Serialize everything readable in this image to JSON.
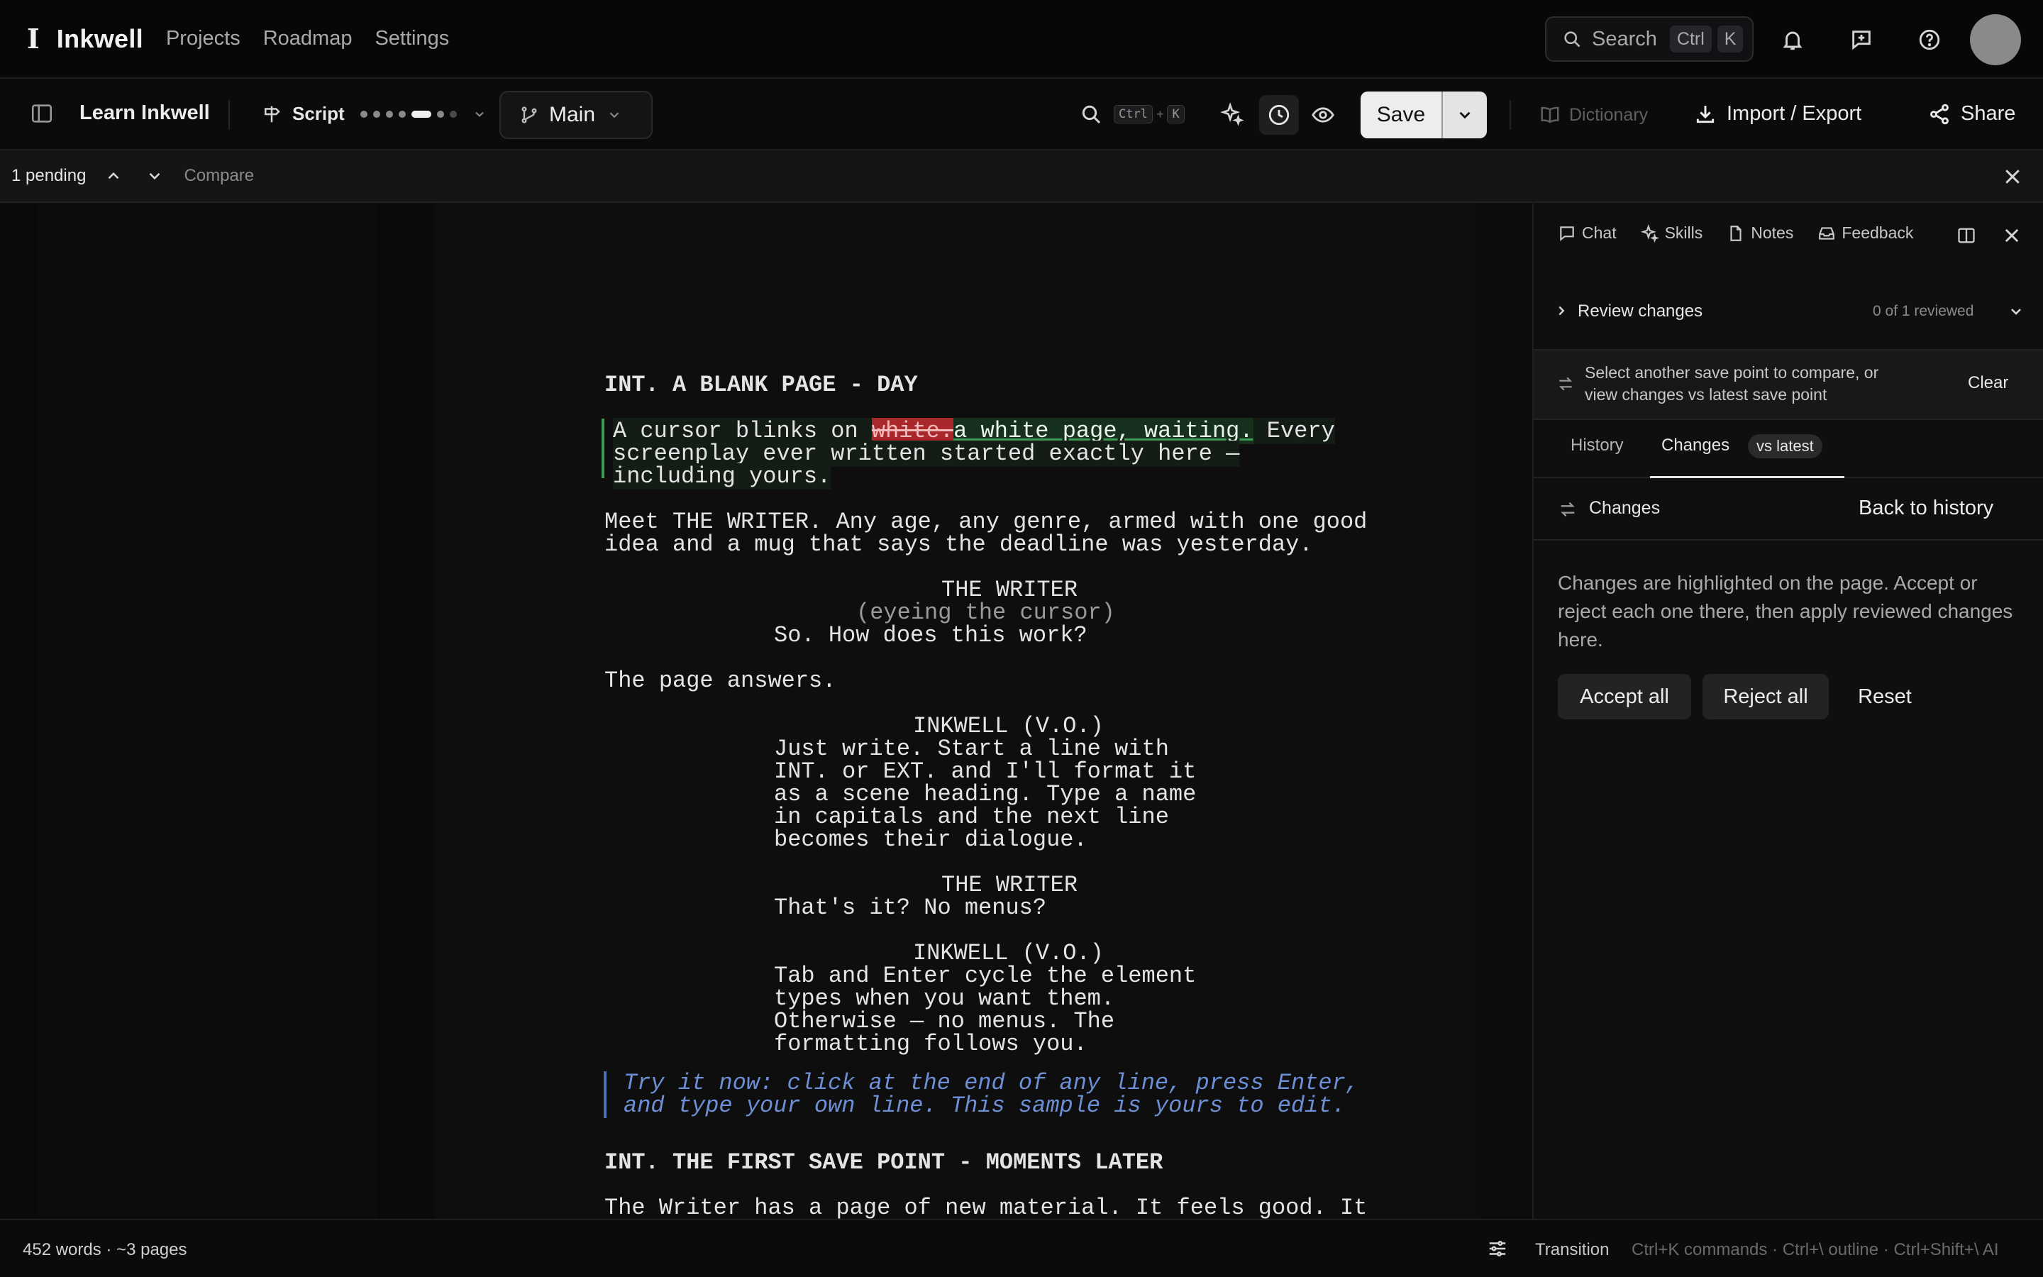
{
  "app": {
    "brand": "Inkwell",
    "brand_glyph": "I",
    "nav": [
      "Projects",
      "Roadmap",
      "Settings"
    ],
    "search": {
      "label": "Search",
      "key1": "Ctrl",
      "key2": "K"
    },
    "icons": [
      "bell-icon",
      "message-icon",
      "help-icon"
    ]
  },
  "toolbar": {
    "doc_title": "Learn Inkwell",
    "script_label": "Script",
    "branch": "Main",
    "find_key1": "Ctrl",
    "find_plus": "+",
    "find_key2": "K",
    "save": "Save",
    "dictionary": "Dictionary",
    "import_export": "Import / Export",
    "share": "Share"
  },
  "pending": {
    "count_label": "1 pending",
    "compare": "Compare"
  },
  "script": {
    "heading1": "INT. A BLANK PAGE - DAY",
    "a1_pre": "A cursor blinks on ",
    "a1_del": "white.",
    "a1_ins": "a white page, waiting.",
    "a1_post": " Every",
    "a1_l2": "screenplay ever written started exactly here —",
    "a1_l3": "including yours.",
    "a2_l1": "Meet THE WRITER. Any age, any genre, armed with one good",
    "a2_l2": "idea and a mug that says the deadline was yesterday.",
    "c1": "THE WRITER",
    "p1": "(eyeing the cursor)",
    "d1": "So. How does this work?",
    "a3": "The page answers.",
    "c2": "INKWELL (V.O.)",
    "d2_l1": "Just write. Start a line with",
    "d2_l2": "INT. or EXT. and I'll format it",
    "d2_l3": "as a scene heading. Type a name",
    "d2_l4": "in capitals and the next line",
    "d2_l5": "becomes their dialogue.",
    "c3": "THE WRITER",
    "d3": "That's it? No menus?",
    "c4": "INKWELL (V.O.)",
    "d4_l1": "Tab and Enter cycle the element",
    "d4_l2": "types when you want them.",
    "d4_l3": "Otherwise — no menus. The",
    "d4_l4": "formatting follows you.",
    "hint_l1": "Try it now: click at the end of any line, press Enter,",
    "hint_l2": "and type your own line. This sample is yours to edit.",
    "heading2": "INT. THE FIRST SAVE POINT - MOMENTS LATER",
    "a4": "The Writer has a page of new material. It feels good. It"
  },
  "panel": {
    "tabs": {
      "chat": "Chat",
      "skills": "Skills",
      "notes": "Notes",
      "feedback": "Feedback"
    },
    "review_title": "Review changes",
    "review_count": "0 of 1 reviewed",
    "compare_l1": "Select another save point to compare, or",
    "compare_l2": "view changes vs latest save point",
    "clear": "Clear",
    "subtab_history": "History",
    "subtab_changes": "Changes",
    "vs_latest": "vs latest",
    "changes_title": "Changes",
    "back": "Back to history",
    "desc": "Changes are highlighted on the page. Accept or reject each one there, then apply reviewed changes here.",
    "accept_all": "Accept all",
    "reject_all": "Reject all",
    "reset": "Reset"
  },
  "status": {
    "words": "452 words · ~3 pages",
    "transition": "Transition",
    "hint": "Ctrl+K commands · Ctrl+\\ outline · Ctrl+Shift+\\ AI"
  },
  "colors": {
    "accent_green": "#3f9a55",
    "deleted_red": "#a8282b",
    "hint_blue": "#6d8fd6"
  }
}
